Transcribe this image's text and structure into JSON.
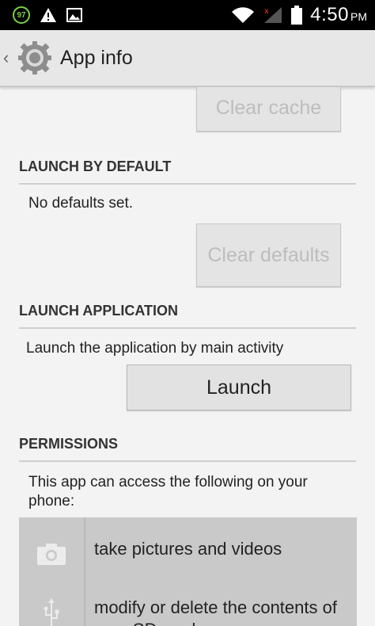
{
  "status_bar": {
    "battery_badge": "97",
    "time": "4:50",
    "ampm": "PM"
  },
  "action_bar": {
    "title": "App info"
  },
  "storage": {
    "clear_cache_label": "Clear cache"
  },
  "launch_by_default": {
    "header": "LAUNCH BY DEFAULT",
    "status_text": "No defaults set.",
    "clear_defaults_label": "Clear defaults"
  },
  "launch_application": {
    "header": "LAUNCH APPLICATION",
    "description": "Launch the application by main activity",
    "launch_label": "Launch"
  },
  "permissions": {
    "header": "PERMISSIONS",
    "description": "This app can access the following on your phone:",
    "items": [
      {
        "label": "take pictures and videos",
        "icon": "camera-icon"
      },
      {
        "label": "modify or delete the contents of your SD card",
        "icon": "usb-icon"
      }
    ]
  }
}
